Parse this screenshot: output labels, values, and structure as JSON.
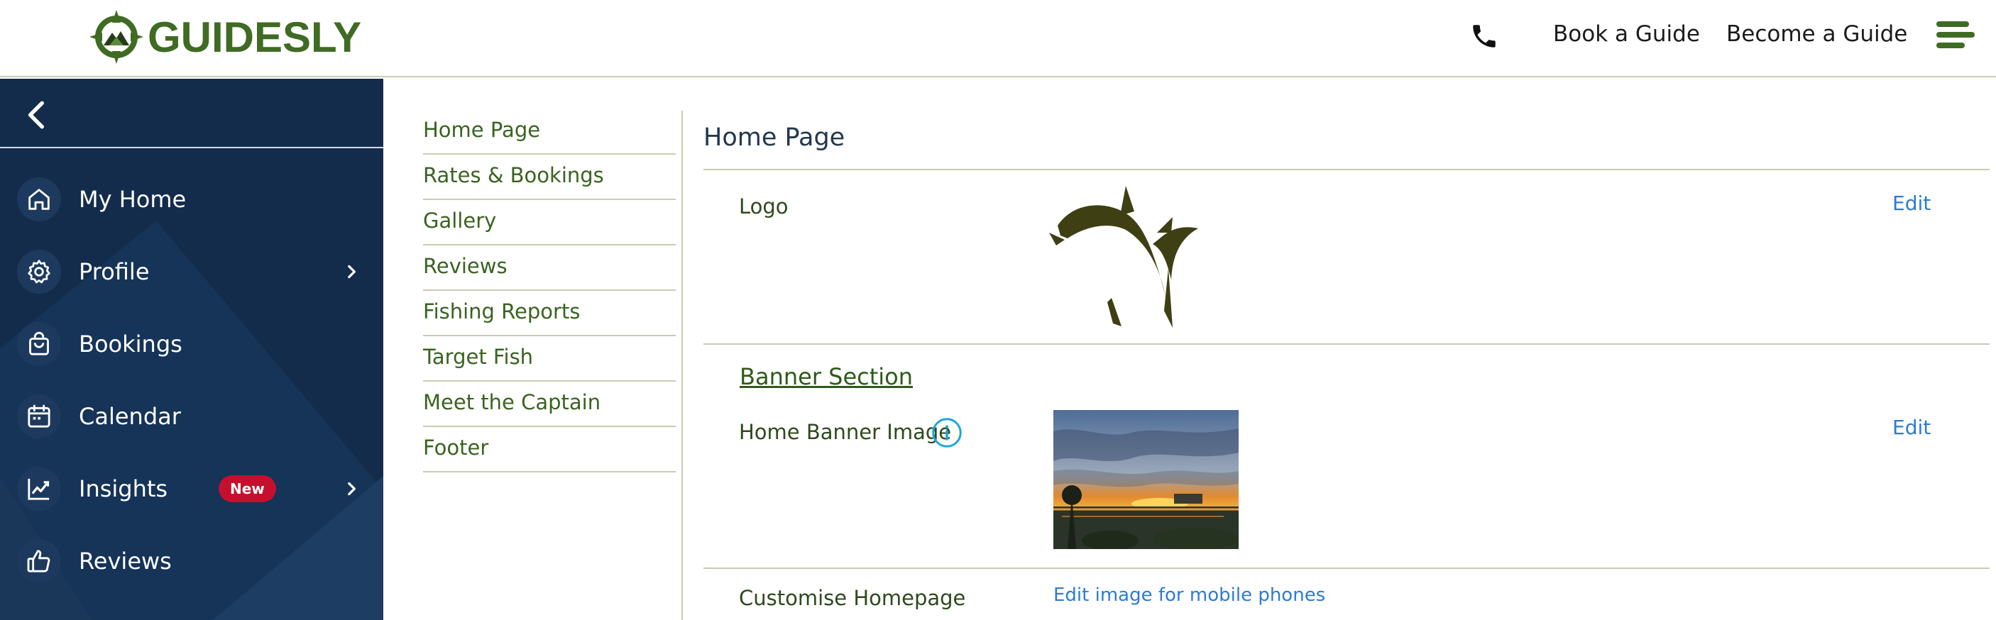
{
  "header": {
    "brand_name": "GUIDESLY",
    "nav": {
      "book_label": "Book a Guide",
      "become_label": "Become a Guide"
    },
    "icons": [
      "compass-logo-icon",
      "phone-icon",
      "hamburger-menu-icon"
    ]
  },
  "sidebar": {
    "items": [
      {
        "label": "My Home",
        "icon": "home-icon",
        "has_chevron": false
      },
      {
        "label": "Profile",
        "icon": "gear-icon",
        "has_chevron": true
      },
      {
        "label": "Bookings",
        "icon": "shopping-bag-icon",
        "has_chevron": false
      },
      {
        "label": "Calendar",
        "icon": "calendar-icon",
        "has_chevron": false
      },
      {
        "label": "Insights",
        "icon": "trend-chart-icon",
        "has_chevron": true,
        "badge": "New"
      },
      {
        "label": "Reviews",
        "icon": "thumbs-up-icon",
        "has_chevron": false
      }
    ]
  },
  "sections": {
    "links": [
      "Home Page",
      "Rates & Bookings",
      "Gallery",
      "Reviews",
      "Fishing Reports",
      "Target Fish",
      "Meet the Captain",
      "Footer"
    ]
  },
  "main": {
    "title": "Home Page",
    "logo": {
      "label": "Logo",
      "edit": "Edit"
    },
    "banner": {
      "heading": "Banner Section",
      "image_label": "Home Banner Image",
      "edit": "Edit"
    },
    "customise": {
      "label": "Customise Homepage",
      "mobile_link": "Edit image for mobile phones"
    }
  },
  "colors": {
    "brand_green": "#3f6b22",
    "sidebar_navy": "#132c4c",
    "badge_red": "#c4102e",
    "link_blue": "#2c7bd6"
  }
}
